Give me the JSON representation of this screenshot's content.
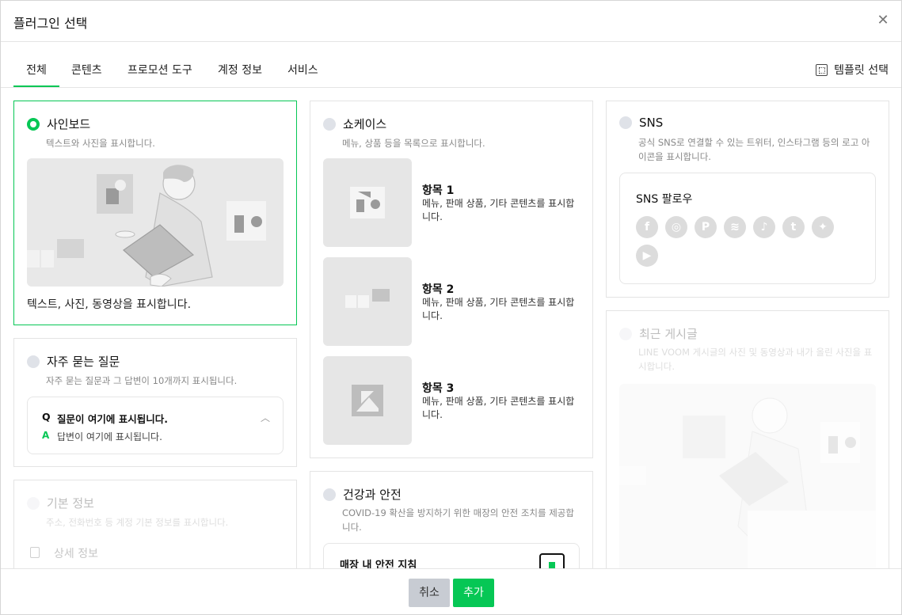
{
  "dialog": {
    "title": "플러그인 선택"
  },
  "tabs": [
    {
      "label": "전체"
    },
    {
      "label": "콘텐츠"
    },
    {
      "label": "프로모션 도구"
    },
    {
      "label": "계정 정보"
    },
    {
      "label": "서비스"
    }
  ],
  "template_select": {
    "label": "템플릿 선택"
  },
  "plugins": {
    "signboard": {
      "title": "사인보드",
      "desc": "텍스트와 사진을 표시합니다.",
      "caption": "텍스트, 사진, 동영상을 표시합니다."
    },
    "faq": {
      "title": "자주 묻는 질문",
      "desc": "자주 묻는 질문과 그 답변이 10개까지 표시됩니다.",
      "q_mark": "Q",
      "question": "질문이 여기에 표시됩니다.",
      "a_mark": "A",
      "answer": "답변이 여기에 표시됩니다."
    },
    "basic_info": {
      "title": "기본 정보",
      "desc": "주소, 전화번호 등 계정 기본 정보를 표시합니다.",
      "detail": "상세 정보"
    },
    "showcase": {
      "title": "쇼케이스",
      "desc": "메뉴, 상품 등을 목록으로 표시합니다.",
      "items": [
        {
          "title": "항목 1",
          "desc": "메뉴, 판매 상품, 기타 콘텐츠를 표시합니다."
        },
        {
          "title": "항목 2",
          "desc": "메뉴, 판매 상품, 기타 콘텐츠를 표시합니다."
        },
        {
          "title": "항목 3",
          "desc": "메뉴, 판매 상품, 기타 콘텐츠를 표시합니다."
        }
      ]
    },
    "health": {
      "title": "건강과 안전",
      "desc": "COVID-19 확산을 방지하기 위한 매장의 안전 조치를 제공합니다.",
      "box_title": "매장 내 안전 지침"
    },
    "sns": {
      "title": "SNS",
      "desc": "공식 SNS로 연결할 수 있는 트위터, 인스타그램 등의 로고 아이콘을 표시합니다.",
      "box_title": "SNS 팔로우",
      "icons": [
        "facebook-icon",
        "instagram-icon",
        "pinterest-icon",
        "spotify-icon",
        "tiktok-icon",
        "tumblr-icon",
        "twitter-icon",
        "youtube-icon"
      ]
    },
    "recent_posts": {
      "title": "최근 게시글",
      "desc": "LINE VOOM 게시글의 사진 및 동영상과 내가 올린 사진을 표시합니다."
    }
  },
  "footer": {
    "cancel": "취소",
    "add": "추가"
  },
  "colors": {
    "accent": "#06c755",
    "radio_off": "#dfe2e8"
  }
}
